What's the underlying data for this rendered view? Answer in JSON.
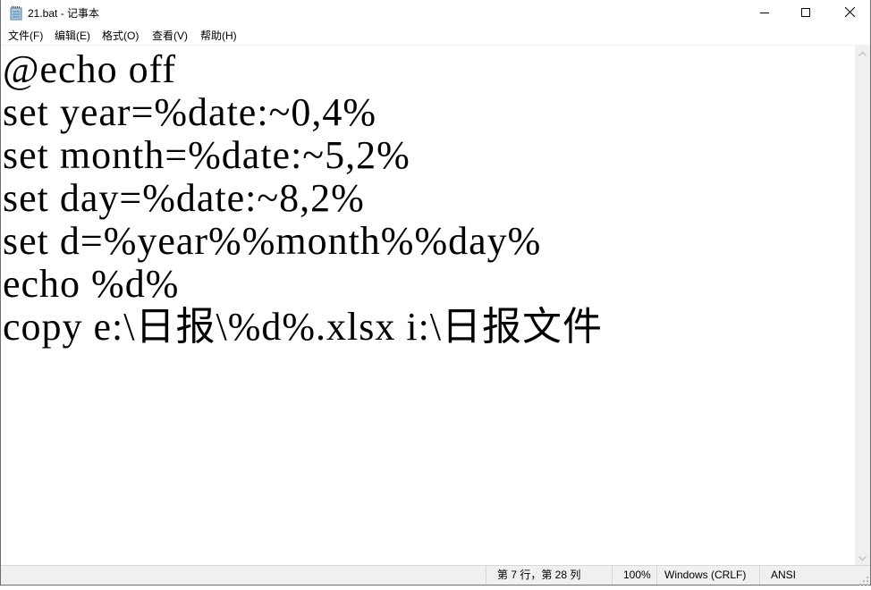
{
  "window": {
    "title": "21.bat - 记事本",
    "icon": "notepad-icon",
    "controls": {
      "minimize": "minimize-icon",
      "maximize": "maximize-icon",
      "close": "close-icon"
    }
  },
  "menubar": {
    "items": [
      {
        "label": "文件(F)"
      },
      {
        "label": "编辑(E)"
      },
      {
        "label": "格式(O)"
      },
      {
        "label": "查看(V)"
      },
      {
        "label": "帮助(H)"
      }
    ]
  },
  "editor": {
    "lines": [
      "@echo off",
      "set year=%date:~0,4%",
      "set month=%date:~5,2%",
      "set day=%date:~8,2%",
      "set d=%year%%month%%day%",
      "echo %d%",
      "copy e:\\日报\\%d%.xlsx i:\\日报文件"
    ]
  },
  "statusbar": {
    "position": "第 7 行，第 28 列",
    "zoom": "100%",
    "line_ending": "Windows (CRLF)",
    "encoding": "ANSI"
  },
  "colors": {
    "chrome_bg": "#f0f0f0",
    "border": "#6e6e6e",
    "text": "#000000"
  }
}
